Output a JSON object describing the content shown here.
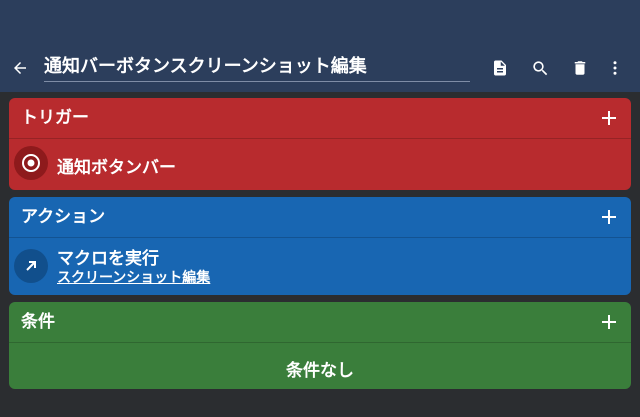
{
  "header": {
    "title": "通知バーボタンスクリーンショット編集",
    "icons": [
      "back-arrow-icon",
      "document-icon",
      "search-icon",
      "delete-icon",
      "more-vert-icon"
    ]
  },
  "trigger": {
    "title": "トリガー",
    "color": "#b82b2e",
    "item_label": "通知ボタンバー",
    "item_icon": "radio-target-icon"
  },
  "action": {
    "title": "アクション",
    "color": "#1866b2",
    "item_label": "マクロを実行",
    "item_sub": "スクリーンショット編集",
    "item_icon": "arrow-up-right-icon"
  },
  "condition": {
    "title": "条件",
    "color": "#3a7e3b",
    "empty_text": "条件なし"
  }
}
